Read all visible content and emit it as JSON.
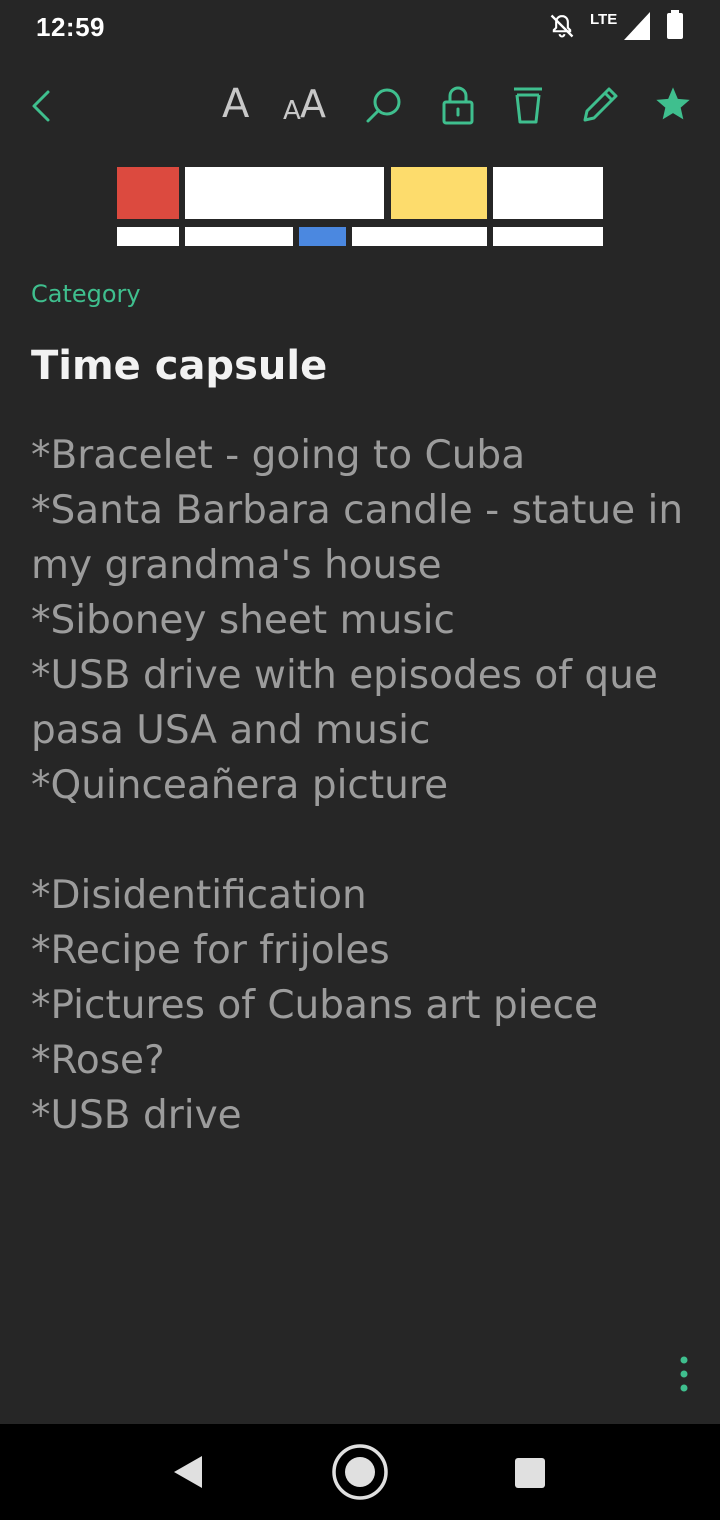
{
  "status_bar": {
    "time": "12:59",
    "network_label": "LTE",
    "icons": [
      "notifications-off-icon",
      "signal-icon",
      "battery-icon"
    ]
  },
  "toolbar": {
    "actions": [
      "back",
      "font",
      "font-size",
      "search",
      "lock",
      "delete",
      "edit",
      "favorite"
    ],
    "font_glyph": "A",
    "font_size_glyph_small": "A",
    "font_size_glyph_large": "A",
    "favorite": true
  },
  "colors": {
    "background": "#262626",
    "accent": "#3fbf8e",
    "title": "#f2f2f2",
    "body_text": "#9c9c9c",
    "cover_red": "#dc4a3f",
    "cover_yellow": "#fddc6c",
    "cover_blue": "#4b88e0",
    "cover_white": "#ffffff"
  },
  "note": {
    "category": "Category",
    "title": "Time capsule",
    "lines": [
      "*Bracelet - going to Cuba",
      "*Santa Barbara candle - statue in",
      "my grandma's house",
      "*Siboney sheet music",
      "*USB drive with episodes of que",
      "pasa USA and music",
      "*Quinceañera picture",
      "",
      "*Disidentification",
      "*Recipe for frijoles",
      "*Pictures of Cubans art piece",
      "*Rose?",
      "*USB drive"
    ]
  },
  "nav_bar": {
    "buttons": [
      "back-icon",
      "home-icon",
      "recents-icon"
    ]
  }
}
